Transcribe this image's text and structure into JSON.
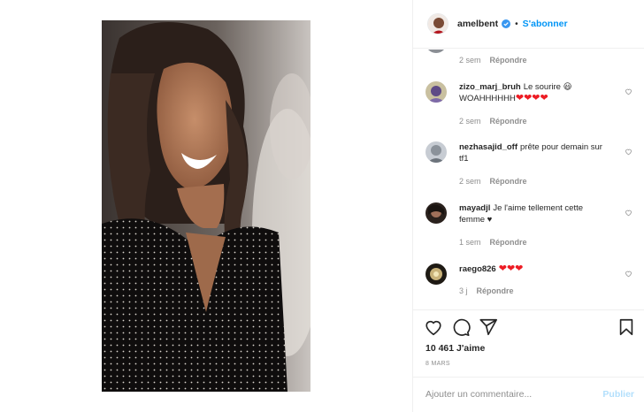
{
  "post": {
    "username": "amelbent",
    "follow_label": "S'abonner",
    "dot": "•",
    "likes": "10 461 J'aime",
    "date": "8 MARS",
    "add_comment_placeholder": "Ajouter un commentaire...",
    "publish_label": "Publier"
  },
  "partial_comment": {
    "time": "2 sem",
    "reply": "Répondre"
  },
  "comments": [
    {
      "user": "zizo_marj_bruh",
      "text": "Le sourire 😃 WOAHHHHHH",
      "hearts": "❤❤❤❤",
      "time": "2 sem",
      "reply": "Répondre"
    },
    {
      "user": "nezhasajid_off",
      "text": "prête pour demain sur tf1",
      "time": "2 sem",
      "reply": "Répondre"
    },
    {
      "user": "mayadjl",
      "text": "Je l'aime tellement cette femme ♥",
      "time": "1 sem",
      "reply": "Répondre"
    },
    {
      "user": "raego826",
      "hearts": "❤❤❤",
      "time": "3 j",
      "reply": "Répondre"
    }
  ],
  "colors": {
    "accent": "#0095f6",
    "heart": "#ed1c24",
    "muted": "#8e8e8e"
  },
  "icons": [
    "verified-icon",
    "heart-icon",
    "comment-icon",
    "share-icon",
    "bookmark-icon"
  ]
}
